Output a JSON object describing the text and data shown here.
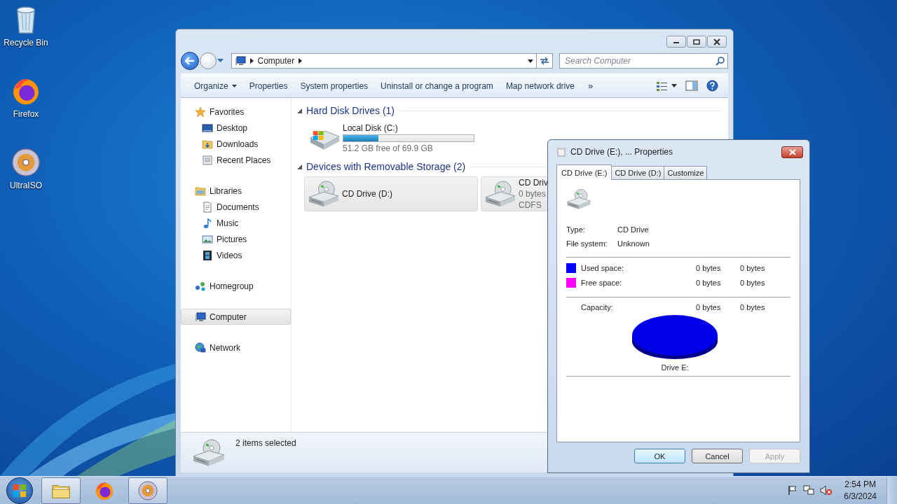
{
  "desktop_icons": [
    {
      "label": "Recycle Bin",
      "kind": "recycle"
    },
    {
      "label": "Firefox",
      "kind": "firefox"
    },
    {
      "label": "UltraISO",
      "kind": "disc"
    }
  ],
  "explorer": {
    "breadcrumb": [
      "Computer"
    ],
    "search": {
      "placeholder": "Search Computer"
    },
    "commands": [
      {
        "label": "Organize",
        "menu": true
      },
      {
        "label": "Properties",
        "menu": false
      },
      {
        "label": "System properties",
        "menu": false
      },
      {
        "label": "Uninstall or change a program",
        "menu": false
      },
      {
        "label": "Map network drive",
        "menu": false
      }
    ],
    "more": "»",
    "nav": [
      {
        "label": "Favorites",
        "kind": "star",
        "selected": false,
        "children": [
          {
            "label": "Desktop",
            "kind": "desktop",
            "selected": false
          },
          {
            "label": "Downloads",
            "kind": "downloads",
            "selected": false
          },
          {
            "label": "Recent Places",
            "kind": "recent",
            "selected": false
          }
        ]
      },
      {
        "label": "Libraries",
        "kind": "library",
        "selected": false,
        "children": [
          {
            "label": "Documents",
            "kind": "document",
            "selected": false
          },
          {
            "label": "Music",
            "kind": "music",
            "selected": false
          },
          {
            "label": "Pictures",
            "kind": "pictures",
            "selected": false
          },
          {
            "label": "Videos",
            "kind": "videos",
            "selected": false
          }
        ]
      },
      {
        "label": "Homegroup",
        "kind": "homegroup",
        "selected": false
      },
      {
        "label": "Computer",
        "kind": "computer",
        "selected": true
      },
      {
        "label": "Network",
        "kind": "network",
        "selected": false
      }
    ],
    "sections": [
      {
        "title": "Hard Disk Drives (1)",
        "expanded": true,
        "items": [
          {
            "kind": "disk",
            "name": "Local Disk (C:)",
            "level": 0.27,
            "lines": [
              "51.2 GB free of 69.9 GB"
            ],
            "selected": false
          }
        ]
      },
      {
        "title": "Devices with Removable Storage (2)",
        "expanded": true,
        "items": [
          {
            "kind": "cd",
            "name": "CD Drive (D:)",
            "selected": true
          },
          {
            "kind": "cd",
            "name": "CD Driv",
            "lines": [
              "0 bytes",
              "CDFS"
            ],
            "selected": true
          }
        ]
      }
    ],
    "status": "2 items selected"
  },
  "dialog": {
    "title": "CD Drive (E:), ... Properties",
    "tabs": [
      {
        "label": "CD Drive (E:)",
        "selected": true
      },
      {
        "label": "CD Drive (D:)",
        "selected": false
      },
      {
        "label": "Customize",
        "selected": false
      }
    ],
    "fields": [
      {
        "label": "Type:",
        "value": "CD Drive"
      },
      {
        "label": "File system:",
        "value": "Unknown"
      }
    ],
    "space": [
      {
        "label": "Used space:",
        "color": "#0000ff",
        "bytes": "0 bytes",
        "size": "0 bytes"
      },
      {
        "label": "Free space:",
        "color": "#ff00ff",
        "bytes": "0 bytes",
        "size": "0 bytes"
      }
    ],
    "capacity": {
      "label": "Capacity:",
      "bytes": "0 bytes",
      "size": "0 bytes"
    },
    "drive_label": "Drive E:",
    "buttons": [
      {
        "label": "OK",
        "default": true,
        "disabled": false
      },
      {
        "label": "Cancel",
        "default": false,
        "disabled": false
      },
      {
        "label": "Apply",
        "default": false,
        "disabled": true
      }
    ]
  },
  "taskbar": {
    "apps": [
      {
        "kind": "folder",
        "selected": true
      },
      {
        "kind": "firefox",
        "selected": false
      },
      {
        "kind": "disc",
        "selected": true
      }
    ],
    "time": "2:54 PM",
    "date": "6/3/2024"
  }
}
